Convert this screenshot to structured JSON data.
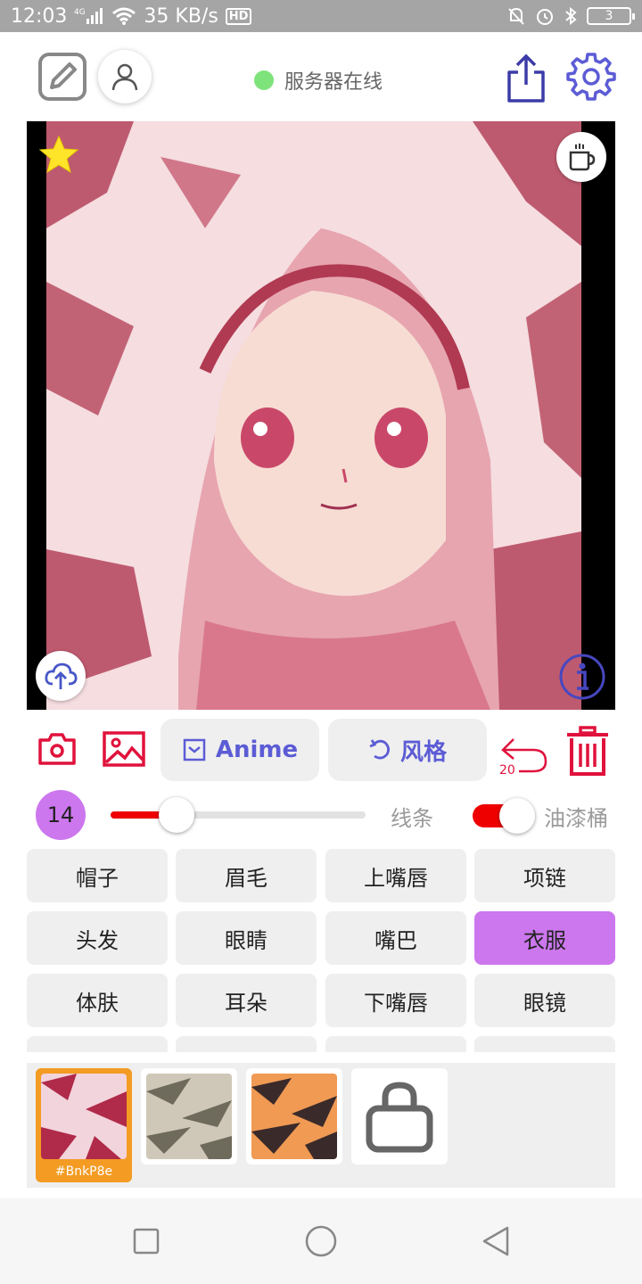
{
  "status_bar": {
    "time": "12:03",
    "network": "4G",
    "speed": "35 KB/s",
    "hd": "HD",
    "battery": "3"
  },
  "header": {
    "server_status": "服务器在线",
    "server_status_color": "#7ee37b"
  },
  "toolbar": {
    "anime_label": "Anime",
    "style_label": "风格",
    "undo_count": "20"
  },
  "brush": {
    "size": "14",
    "level_percent": 26,
    "line_label": "线条",
    "bucket_label": "油漆桶",
    "bucket_enabled": true
  },
  "parts": [
    "帽子",
    "眉毛",
    "上嘴唇",
    "项链",
    "头发",
    "眼睛",
    "嘴巴",
    "衣服",
    "体肤",
    "耳朵",
    "下嘴唇",
    "眼镜"
  ],
  "parts_active": "衣服",
  "swatches": {
    "selected_code": "#BnkP8e"
  },
  "colors": {
    "accent_purple": "#cc77ee",
    "accent_red": "#ee0000",
    "icon_blue": "#5c5cd6",
    "icon_pink": "#e0123c"
  },
  "icons": [
    "edit-icon",
    "user-icon",
    "share-icon",
    "gear-icon",
    "star-icon",
    "coffee-icon",
    "upload-cloud-icon",
    "info-icon",
    "camera-icon",
    "image-icon",
    "undo-icon",
    "trash-icon",
    "bag-icon"
  ]
}
